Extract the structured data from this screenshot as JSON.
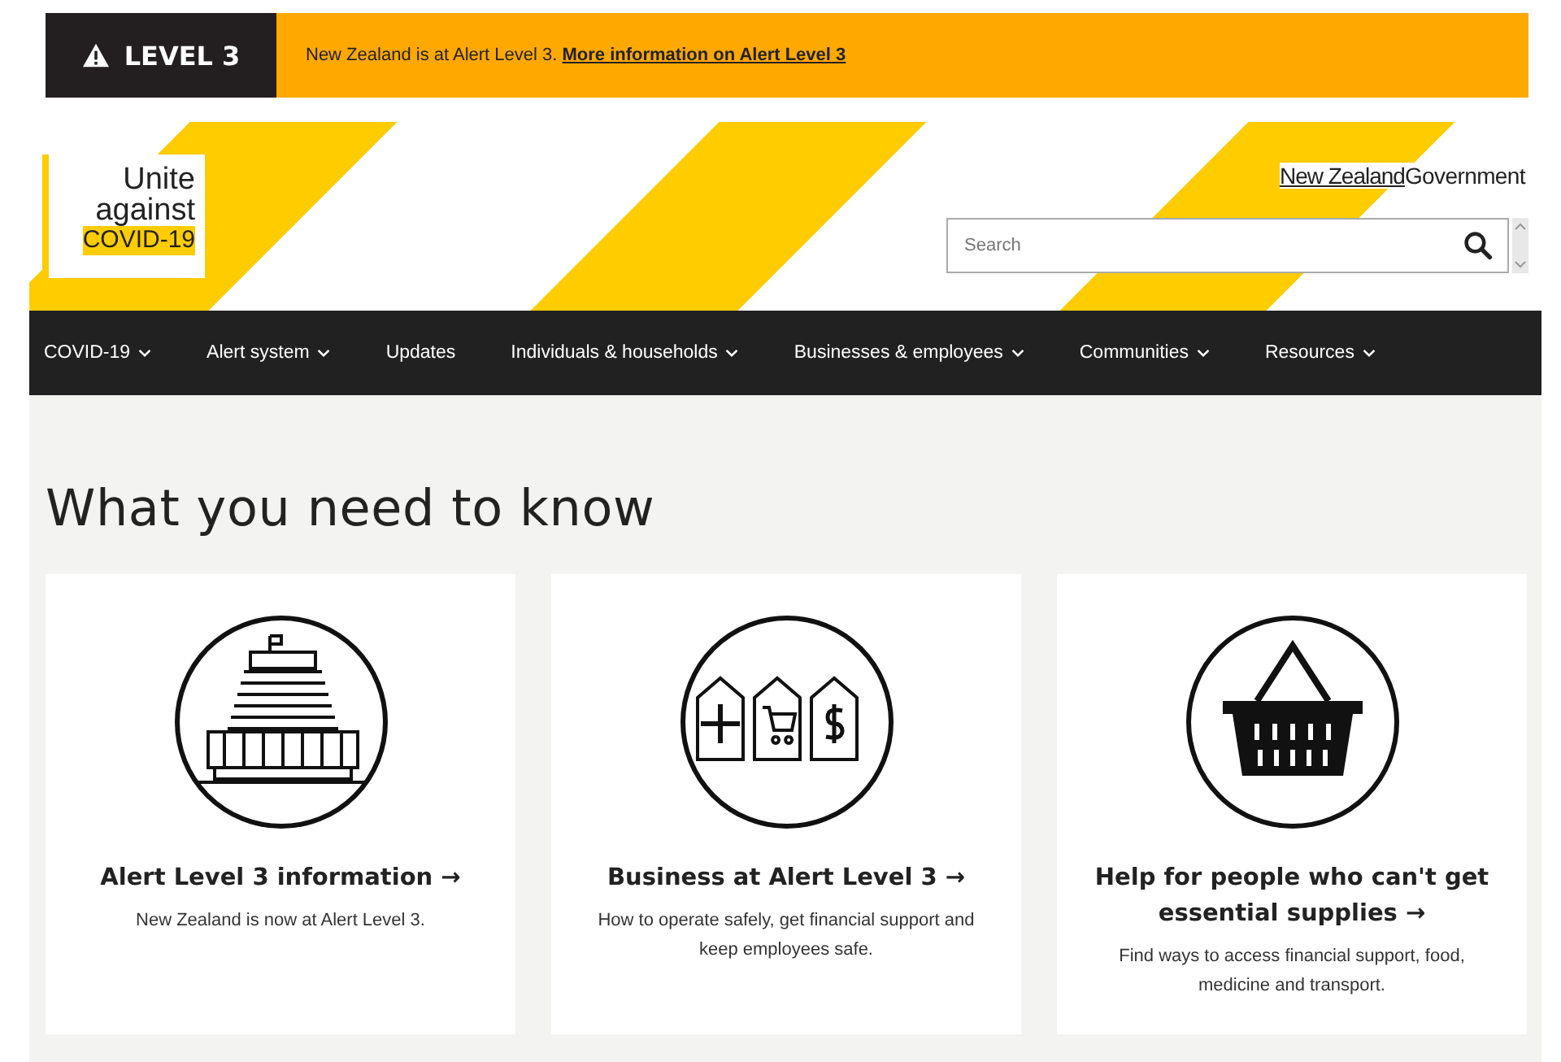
{
  "alert_bar": {
    "level_label": "LEVEL 3",
    "message": "New Zealand is at Alert Level 3.",
    "link": "More information on Alert Level 3"
  },
  "header": {
    "logo": {
      "line_1": "Unite",
      "line_2": "against",
      "line_3": "COVID-19"
    },
    "government_logo": {
      "primary": "New Zealand",
      "secondary": "Government"
    },
    "search": {
      "placeholder": "Search"
    }
  },
  "nav": {
    "items": [
      {
        "label": "COVID-19",
        "dropdown": true
      },
      {
        "label": "Alert system",
        "dropdown": true
      },
      {
        "label": "Updates",
        "dropdown": false
      },
      {
        "label": "Individuals & households",
        "dropdown": true
      },
      {
        "label": "Businesses & employees",
        "dropdown": true
      },
      {
        "label": "Communities",
        "dropdown": true
      },
      {
        "label": "Resources",
        "dropdown": true
      }
    ]
  },
  "main": {
    "heading": "What you need to know",
    "cards": [
      {
        "kind": "building",
        "title": "Alert Level 3 information →",
        "text": "New Zealand is now at Alert Level 3."
      },
      {
        "kind": "shops",
        "title": "Business at Alert Level 3 →",
        "text": "How to operate safely, get financial support and keep employees safe."
      },
      {
        "kind": "basket",
        "title": "Help for people who can't get essential supplies →",
        "text": "Find ways to access financial support, food, medicine and transport."
      }
    ]
  }
}
